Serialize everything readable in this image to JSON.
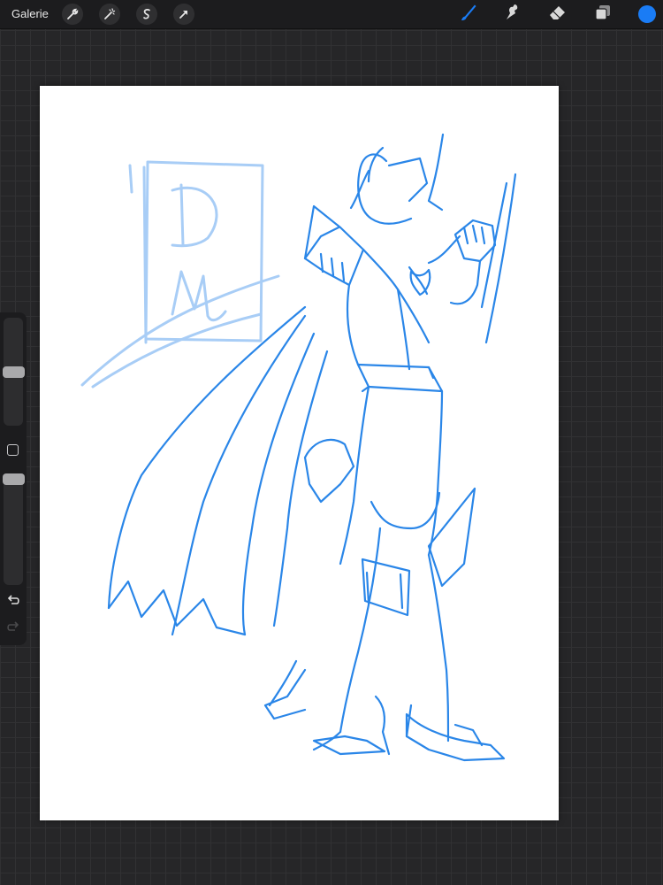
{
  "toolbar": {
    "gallery_label": "Galerie",
    "left_tools": [
      "wrench-icon",
      "magic-wand-icon",
      "selection-icon",
      "transform-arrow-icon"
    ],
    "right_tools": [
      "brush-icon",
      "smudge-icon",
      "eraser-icon",
      "layers-icon"
    ],
    "active_tool": "brush-icon",
    "current_color": "#1a7cf5"
  },
  "sidebar": {
    "brush_size_level": 0.5,
    "opacity_level": 1.0,
    "icons": [
      "modify-square-icon",
      "undo-icon",
      "redo-icon"
    ]
  },
  "canvas": {
    "background": "#ffffff",
    "sketch_color": "#2a86e8",
    "watermark_color": "#a8cdf6",
    "watermark_text": "DM"
  }
}
